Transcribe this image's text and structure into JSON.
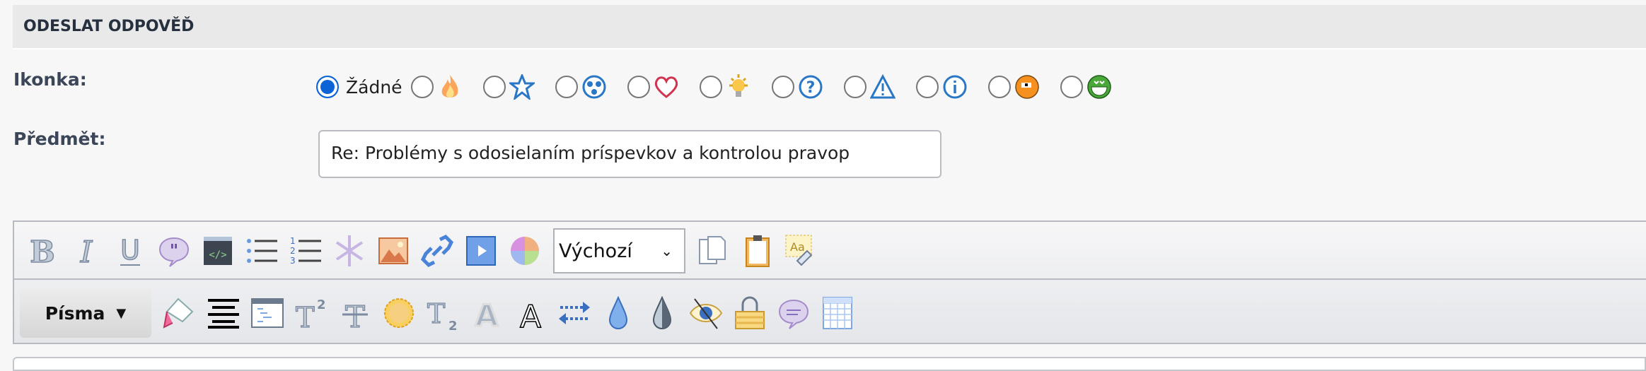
{
  "header": {
    "title": "ODESLAT ODPOVĚĎ"
  },
  "icon_field": {
    "label": "Ikonka:",
    "none_label": "Žádné",
    "selected": "none",
    "options": [
      "none",
      "fire-icon",
      "star-icon",
      "radioactive-icon",
      "heart-icon",
      "lightbulb-icon",
      "question-icon",
      "warning-icon",
      "info-icon",
      "surprised-face-icon",
      "grin-face-icon"
    ]
  },
  "subject_field": {
    "label": "Předmět:",
    "value": "Re: Problémy s odosielaním príspevkov a kontrolou pravop"
  },
  "toolbar": {
    "size_select": "Výchozí",
    "fonts_button": "Písma"
  }
}
